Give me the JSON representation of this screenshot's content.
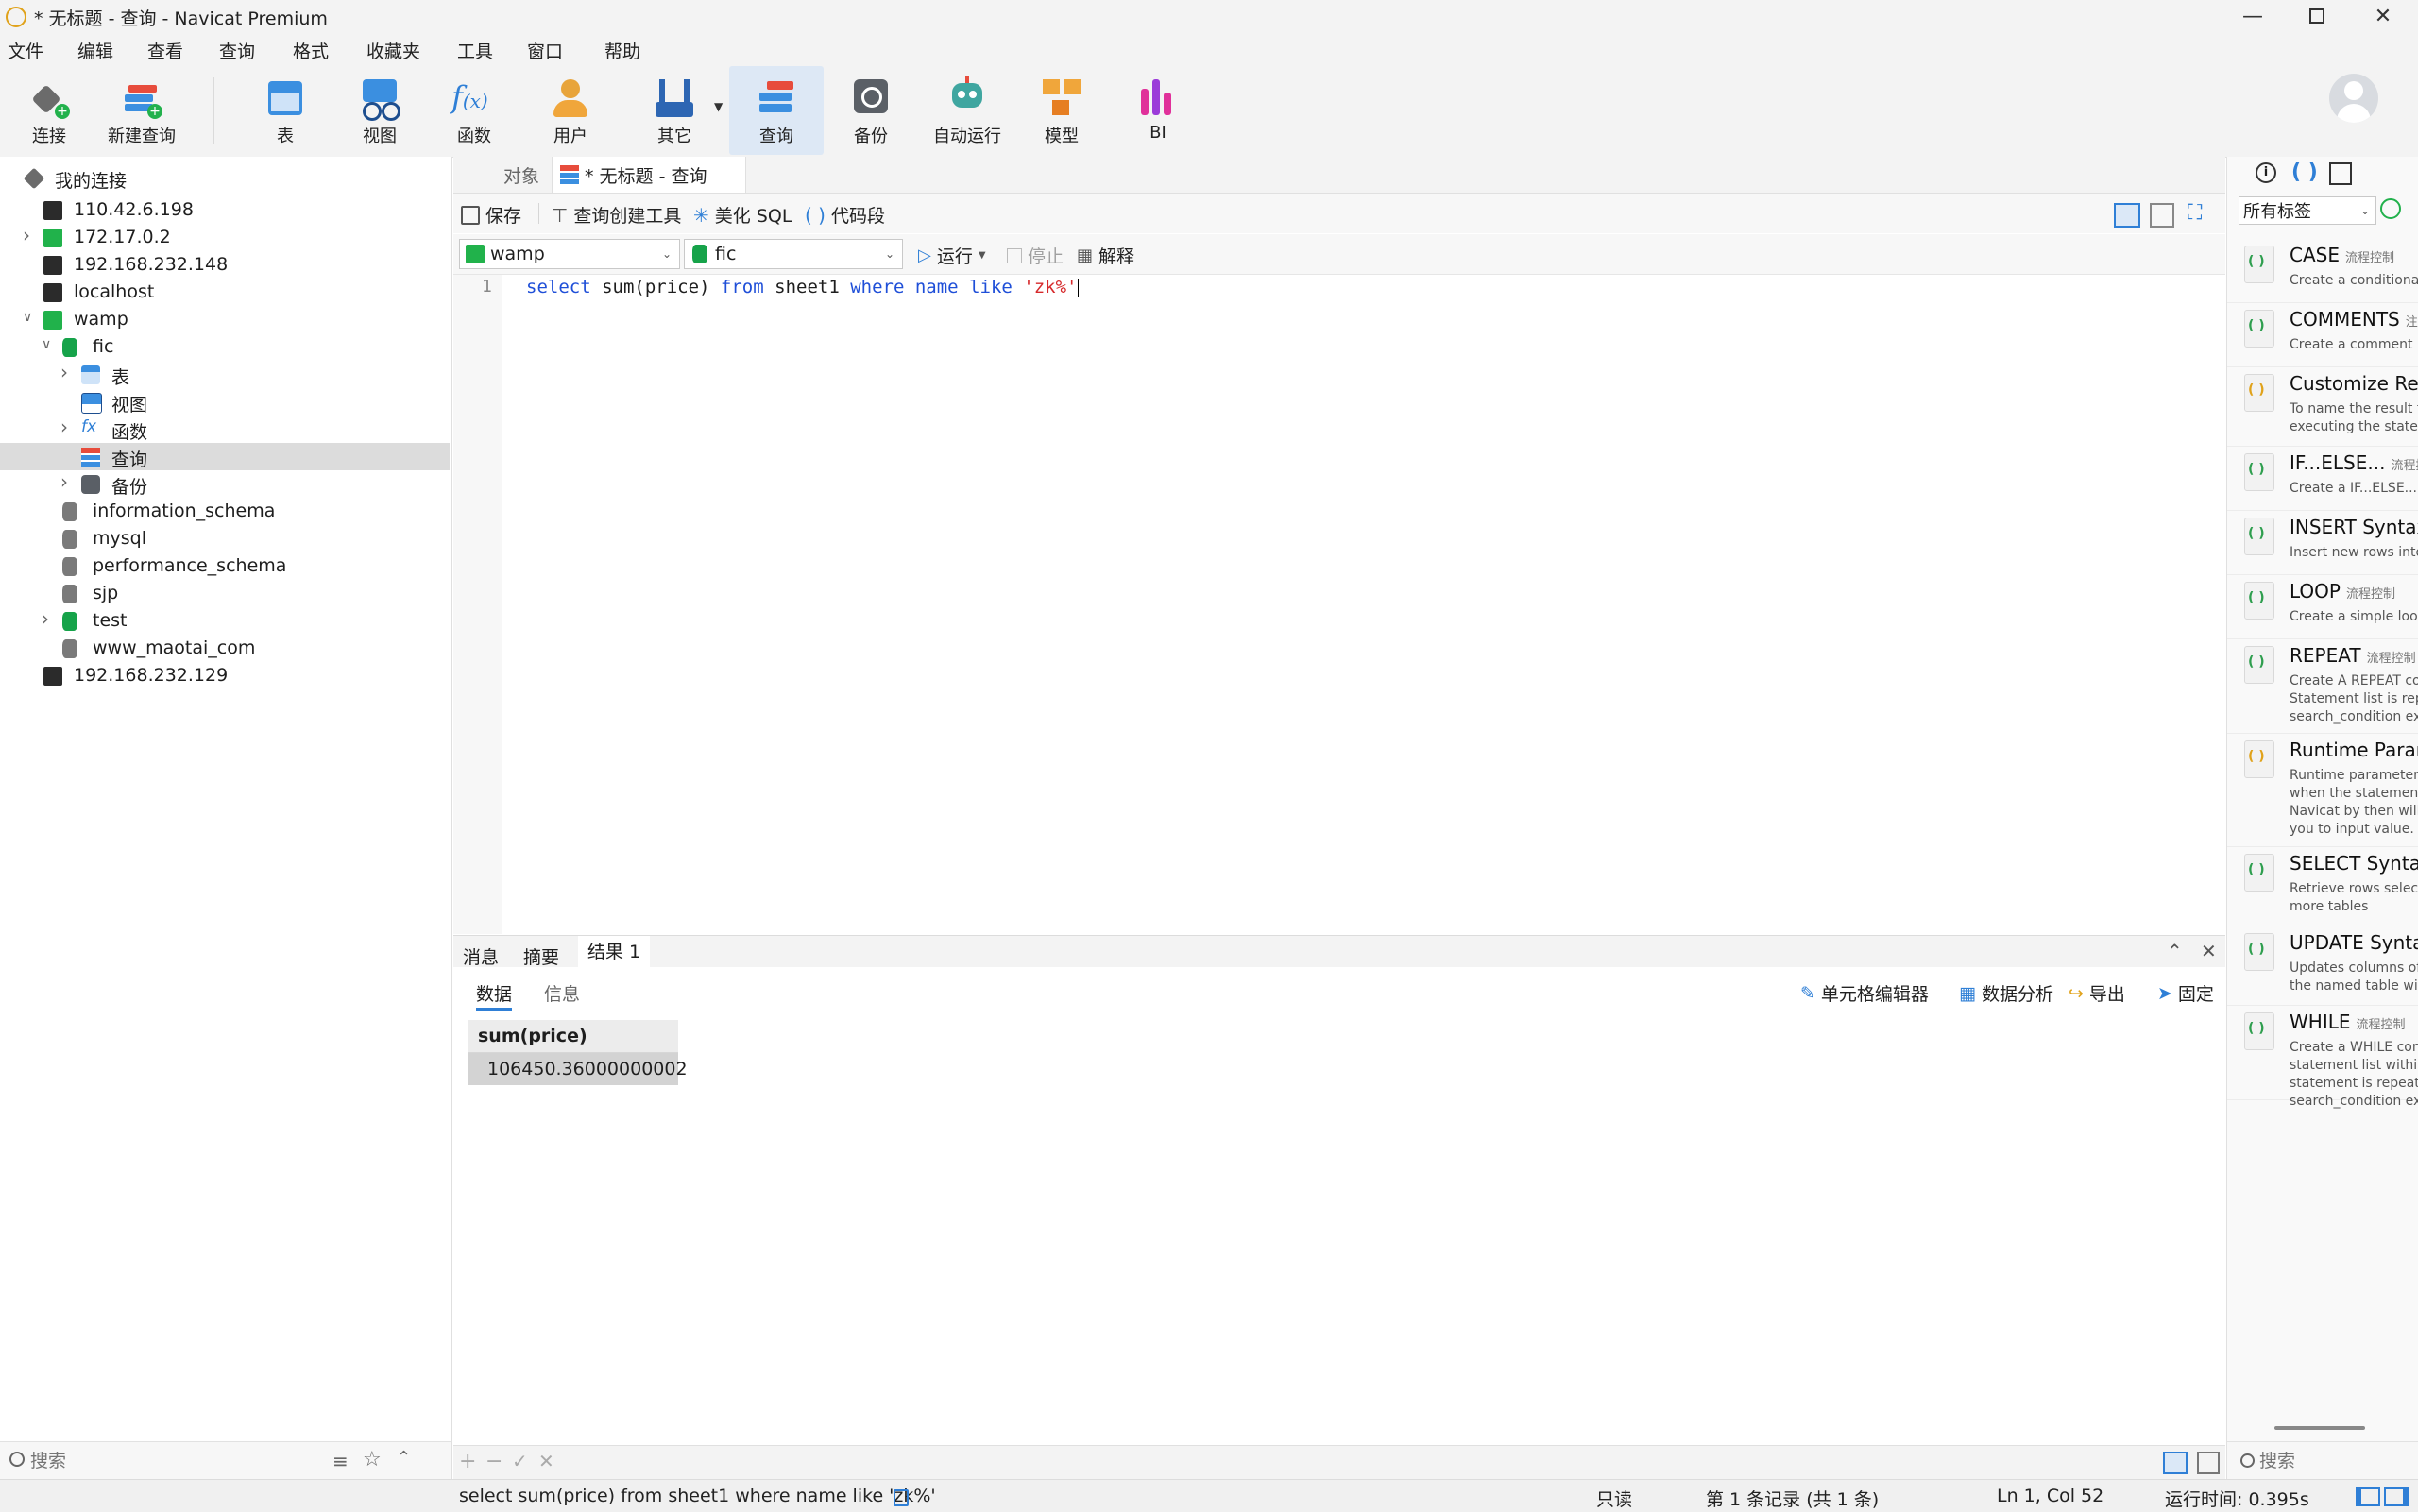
{
  "window": {
    "title": "* 无标题 - 查询 - Navicat Premium",
    "controls": [
      "minimize",
      "maximize",
      "close"
    ]
  },
  "menu": [
    "文件",
    "编辑",
    "查看",
    "查询",
    "格式",
    "收藏夹",
    "工具",
    "窗口",
    "帮助"
  ],
  "toolbar": {
    "items": [
      {
        "id": "connect",
        "label": "连接",
        "icon": "plug-icon"
      },
      {
        "id": "new-query",
        "label": "新建查询",
        "icon": "new-query-icon"
      },
      {
        "id": "table",
        "label": "表",
        "icon": "table-icon"
      },
      {
        "id": "view",
        "label": "视图",
        "icon": "view-icon"
      },
      {
        "id": "function",
        "label": "函数",
        "icon": "function-icon"
      },
      {
        "id": "user",
        "label": "用户",
        "icon": "user-icon"
      },
      {
        "id": "other",
        "label": "其它",
        "icon": "tools-icon"
      },
      {
        "id": "query",
        "label": "查询",
        "icon": "query-icon"
      },
      {
        "id": "backup",
        "label": "备份",
        "icon": "backup-icon"
      },
      {
        "id": "automation",
        "label": "自动运行",
        "icon": "robot-icon"
      },
      {
        "id": "model",
        "label": "模型",
        "icon": "model-icon"
      },
      {
        "id": "bi",
        "label": "BI",
        "icon": "bi-icon"
      }
    ],
    "active": "query"
  },
  "tree": {
    "root": "我的连接",
    "rows": [
      {
        "label": "110.42.6.198",
        "level": 1,
        "type": "server"
      },
      {
        "label": "172.17.0.2",
        "level": 1,
        "type": "server-green",
        "expandable": true
      },
      {
        "label": "192.168.232.148",
        "level": 1,
        "type": "server"
      },
      {
        "label": "localhost",
        "level": 1,
        "type": "server"
      },
      {
        "label": "wamp",
        "level": 1,
        "type": "server-green",
        "expanded": true
      },
      {
        "label": "fic",
        "level": 2,
        "type": "db-green",
        "expanded": true
      },
      {
        "label": "表",
        "level": 3,
        "type": "table",
        "expandable": true
      },
      {
        "label": "视图",
        "level": 3,
        "type": "view"
      },
      {
        "label": "函数",
        "level": 3,
        "type": "function",
        "expandable": true
      },
      {
        "label": "查询",
        "level": 3,
        "type": "query",
        "selected": true
      },
      {
        "label": "备份",
        "level": 3,
        "type": "backup",
        "expandable": true
      },
      {
        "label": "information_schema",
        "level": 2,
        "type": "db-gray"
      },
      {
        "label": "mysql",
        "level": 2,
        "type": "db-gray"
      },
      {
        "label": "performance_schema",
        "level": 2,
        "type": "db-gray"
      },
      {
        "label": "sjp",
        "level": 2,
        "type": "db-gray"
      },
      {
        "label": "test",
        "level": 2,
        "type": "db-green",
        "expandable": true
      },
      {
        "label": "www_maotai_com",
        "level": 2,
        "type": "db-gray"
      },
      {
        "label": "192.168.232.129",
        "level": 1,
        "type": "server-mongo"
      }
    ],
    "search_placeholder": "搜索"
  },
  "tabs": [
    {
      "label": "对象",
      "active": false
    },
    {
      "label": "* 无标题 - 查询",
      "active": true
    }
  ],
  "query_toolbar": {
    "save": "保存",
    "builder": "查询创建工具",
    "beautify": "美化 SQL",
    "snippet": "代码段"
  },
  "connection_bar": {
    "connection": "wamp",
    "database": "fic",
    "run": "运行",
    "stop": "停止",
    "explain": "解释"
  },
  "editor": {
    "line_number": "1",
    "tokens": [
      {
        "t": "select",
        "c": "kw"
      },
      {
        "t": " sum(price) ",
        "c": "plain"
      },
      {
        "t": "from",
        "c": "kw"
      },
      {
        "t": " sheet1 ",
        "c": "plain"
      },
      {
        "t": "where",
        "c": "kw"
      },
      {
        "t": " ",
        "c": "plain"
      },
      {
        "t": "name",
        "c": "kw"
      },
      {
        "t": " ",
        "c": "plain"
      },
      {
        "t": "like",
        "c": "kw"
      },
      {
        "t": " ",
        "c": "plain"
      },
      {
        "t": "'zk%'",
        "c": "str"
      }
    ]
  },
  "results": {
    "tabs": [
      "消息",
      "摘要",
      "结果 1"
    ],
    "active_tab": "结果 1",
    "subtabs": [
      "数据",
      "信息"
    ],
    "active_subtab": "数据",
    "actions": [
      "单元格编辑器",
      "数据分析",
      "导出",
      "固定"
    ],
    "columns": [
      "sum(price)"
    ],
    "rows": [
      [
        "106450.36000000002"
      ]
    ]
  },
  "status": {
    "sql": "select sum(price) from sheet1 where name like 'zk%'",
    "mode": "只读",
    "records": "第 1 条记录 (共 1 条)",
    "cursor": "Ln 1, Col 52",
    "time": "运行时间: 0.395s"
  },
  "right_panel": {
    "filter": "所有标签",
    "search_placeholder": "搜索",
    "snippets": [
      {
        "name": "CASE",
        "tag": "流程控制",
        "desc": "Create a conditional c"
      },
      {
        "name": "COMMENTS",
        "tag": "注",
        "desc": "Create a comment"
      },
      {
        "name": "Customize Res",
        "tag": "",
        "desc": "To name the result tab\nexecuting the stateme"
      },
      {
        "name": "IF...ELSE...",
        "tag": "流程控",
        "desc": "Create a IF...ELSE... co"
      },
      {
        "name": "INSERT Syntax",
        "tag": "",
        "desc": "Insert new rows into a"
      },
      {
        "name": "LOOP",
        "tag": "流程控制",
        "desc": "Create a simple loop c"
      },
      {
        "name": "REPEAT",
        "tag": "流程控制",
        "desc": "Create A REPEAT cons\nStatement list is repea\nsearch_condition expr"
      },
      {
        "name": "Runtime Param",
        "tag": "",
        "desc": "Runtime parameter to\nwhen the statements a\nNavicat by then will p\nyou to input value."
      },
      {
        "name": "SELECT Syntax",
        "tag": "",
        "desc": "Retrieve rows selected\nmore tables"
      },
      {
        "name": "UPDATE Synta",
        "tag": "",
        "desc": "Updates columns of e\nthe named table with"
      },
      {
        "name": "WHILE",
        "tag": "流程控制",
        "desc": "Create a WHILE const\nstatement list within a\nstatement is repeated\nsearch_condition expr"
      }
    ]
  }
}
